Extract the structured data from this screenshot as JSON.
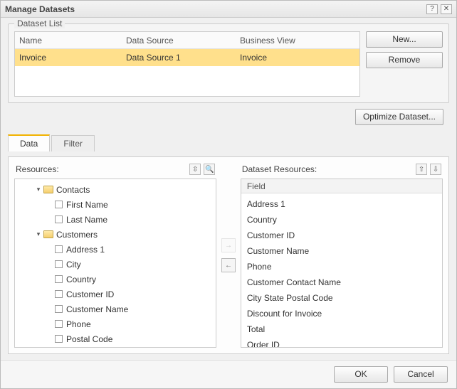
{
  "title": "Manage Datasets",
  "dataset_list": {
    "legend": "Dataset List",
    "headers": {
      "name": "Name",
      "data_source": "Data Source",
      "business_view": "Business View"
    },
    "rows": [
      {
        "name": "Invoice",
        "data_source": "Data Source 1",
        "business_view": "Invoice",
        "selected": true
      }
    ],
    "buttons": {
      "new": "New...",
      "remove": "Remove",
      "optimize": "Optimize Dataset..."
    }
  },
  "tabs": {
    "data": "Data",
    "filter": "Filter",
    "active": "data"
  },
  "resources": {
    "label": "Resources:",
    "tree": [
      {
        "type": "folder",
        "label": "Contacts",
        "expanded": true,
        "depth": 0
      },
      {
        "type": "leaf",
        "label": "First Name",
        "depth": 1
      },
      {
        "type": "leaf",
        "label": "Last Name",
        "depth": 1
      },
      {
        "type": "folder",
        "label": "Customers",
        "expanded": true,
        "depth": 0
      },
      {
        "type": "leaf",
        "label": "Address 1",
        "depth": 1
      },
      {
        "type": "leaf",
        "label": "City",
        "depth": 1
      },
      {
        "type": "leaf",
        "label": "Country",
        "depth": 1
      },
      {
        "type": "leaf",
        "label": "Customer ID",
        "depth": 1
      },
      {
        "type": "leaf",
        "label": "Customer Name",
        "depth": 1
      },
      {
        "type": "leaf",
        "label": "Phone",
        "depth": 1
      },
      {
        "type": "leaf",
        "label": "Postal Code",
        "depth": 1
      }
    ]
  },
  "dataset_resources": {
    "label": "Dataset Resources:",
    "header": "Field",
    "items": [
      "Address 1",
      "Country",
      "Customer ID",
      "Customer Name",
      "Phone",
      "Customer Contact Name",
      "City State Postal Code",
      "Discount for Invoice",
      "Total",
      "Order ID"
    ]
  },
  "footer": {
    "ok": "OK",
    "cancel": "Cancel"
  },
  "glyphs": {
    "help": "?",
    "close": "✕",
    "expand": "⇳",
    "search": "🔍",
    "up": "⇧",
    "down": "⇩",
    "add": "→",
    "remove_arrow": "←",
    "tri_open": "▾"
  }
}
